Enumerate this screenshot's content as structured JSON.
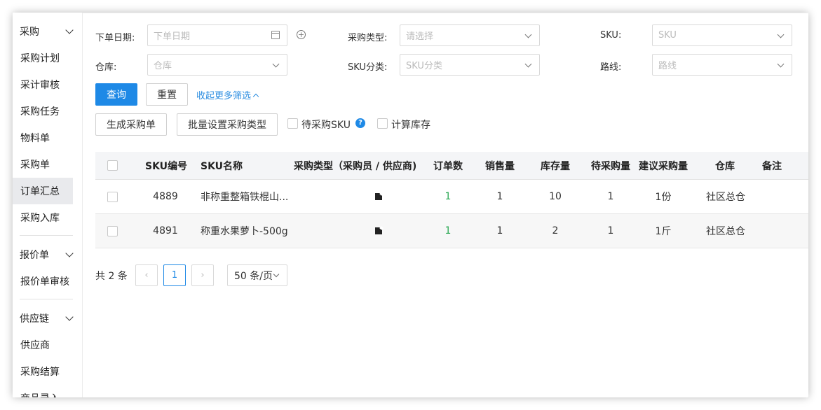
{
  "sidebar": {
    "groups": [
      {
        "label": "采购",
        "items": [
          "采购计划",
          "采计审核",
          "采购任务",
          "物料单",
          "采购单",
          "订单汇总",
          "采购入库"
        ]
      },
      {
        "label": "报价单",
        "items": [
          "报价单审核"
        ]
      },
      {
        "label": "供应链",
        "items": [
          "供应商",
          "采购结算",
          "商品录入"
        ]
      }
    ],
    "active_item": "订单汇总"
  },
  "filters": {
    "order_date_label": "下单日期:",
    "order_date_placeholder": "下单日期",
    "purchase_type_label": "采购类型:",
    "purchase_type_placeholder": "请选择",
    "sku_label": "SKU:",
    "sku_placeholder": "SKU",
    "warehouse_label": "仓库:",
    "warehouse_placeholder": "仓库",
    "sku_category_label": "SKU分类:",
    "sku_category_placeholder": "SKU分类",
    "route_label": "路线:",
    "route_placeholder": "路线"
  },
  "actions": {
    "query": "查询",
    "reset": "重置",
    "collapse_filters": "收起更多筛选",
    "generate_po": "生成采购单",
    "batch_set_type": "批量设置采购类型",
    "pending_sku": "待采购SKU",
    "calc_stock": "计算库存",
    "help_glyph": "?"
  },
  "table": {
    "columns": [
      "SKU编号",
      "SKU名称",
      "采购类型（采购员 / 供应商)",
      "订单数",
      "销售量",
      "库存量",
      "待采购量",
      "建议采购量",
      "仓库",
      "备注"
    ],
    "rows": [
      {
        "sku_id": "4889",
        "sku_name": "非称重整箱铁棍山...",
        "orders": "1",
        "sales": "1",
        "stock": "10",
        "pending": "1",
        "suggested": "1份",
        "warehouse": "社区总仓",
        "note": ""
      },
      {
        "sku_id": "4891",
        "sku_name": "称重水果萝卜-500g",
        "orders": "1",
        "sales": "1",
        "stock": "2",
        "pending": "1",
        "suggested": "1斤",
        "warehouse": "社区总仓",
        "note": ""
      }
    ]
  },
  "pagination": {
    "total": "共 2 条",
    "prev": "‹",
    "current_page": "1",
    "next": "›",
    "page_size": "50 条/页"
  },
  "colors": {
    "primary": "#1e89e6",
    "order_count": "#2aa853"
  }
}
